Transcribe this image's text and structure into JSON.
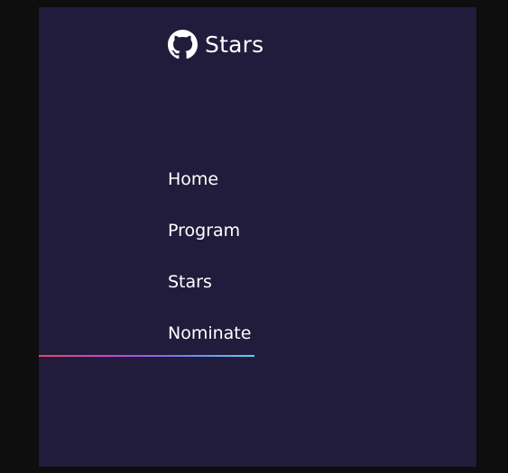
{
  "brand": {
    "title": "Stars",
    "icon": "github-icon"
  },
  "nav": {
    "items": [
      {
        "label": "Home",
        "active": true
      },
      {
        "label": "Program",
        "active": false
      },
      {
        "label": "Stars",
        "active": false
      },
      {
        "label": "Nominate",
        "active": false
      }
    ]
  },
  "colors": {
    "background": "#211c3b",
    "outer": "#0e0e0e",
    "text": "#ffffff",
    "indicator_start": "#e8466a",
    "indicator_end": "#56d3f0"
  }
}
